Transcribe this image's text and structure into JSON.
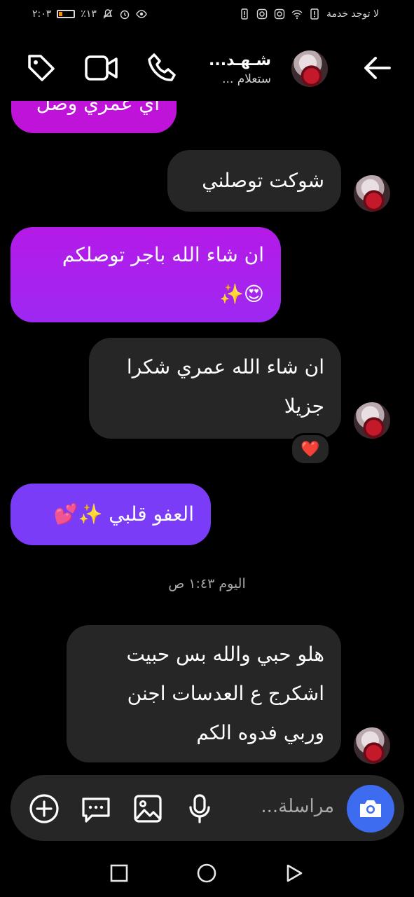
{
  "status_bar": {
    "carrier": "لا توجد خدمة",
    "time": "٢:٠٣",
    "battery": "٪١٣",
    "battery_level": 0.13
  },
  "header": {
    "name": "شـهـد...",
    "status": "ستعلام ..."
  },
  "messages": [
    {
      "text": "اي عمري وصل",
      "side": "out",
      "color": "#c013d9"
    },
    {
      "text": "شوكت توصلني",
      "side": "in"
    },
    {
      "line1": "ان شاء الله باجر توصلكم",
      "line2": "😍✨",
      "side": "out",
      "color": "#b11ef0"
    },
    {
      "line1": "ان شاء الله عمري شكرا",
      "line2": "جزيلا",
      "side": "in",
      "reaction": "❤️"
    },
    {
      "text": "العفو قلبي ✨💕",
      "side": "out",
      "color": "#7b3cf7"
    },
    {
      "line1": "هلو حبي والله بس حبيت",
      "line2": "اشكرج ع العدسات اجنن",
      "line3": "وربي فدوه الكم",
      "side": "in"
    }
  ],
  "timestamp": "اليوم ١:٤٣ ص",
  "composer": {
    "placeholder": "مراسلة..."
  },
  "icons": [
    "back-arrow-icon",
    "phone-icon",
    "video-icon",
    "tag-icon",
    "camera-icon",
    "microphone-icon",
    "gallery-icon",
    "sticker-icon",
    "plus-icon"
  ]
}
